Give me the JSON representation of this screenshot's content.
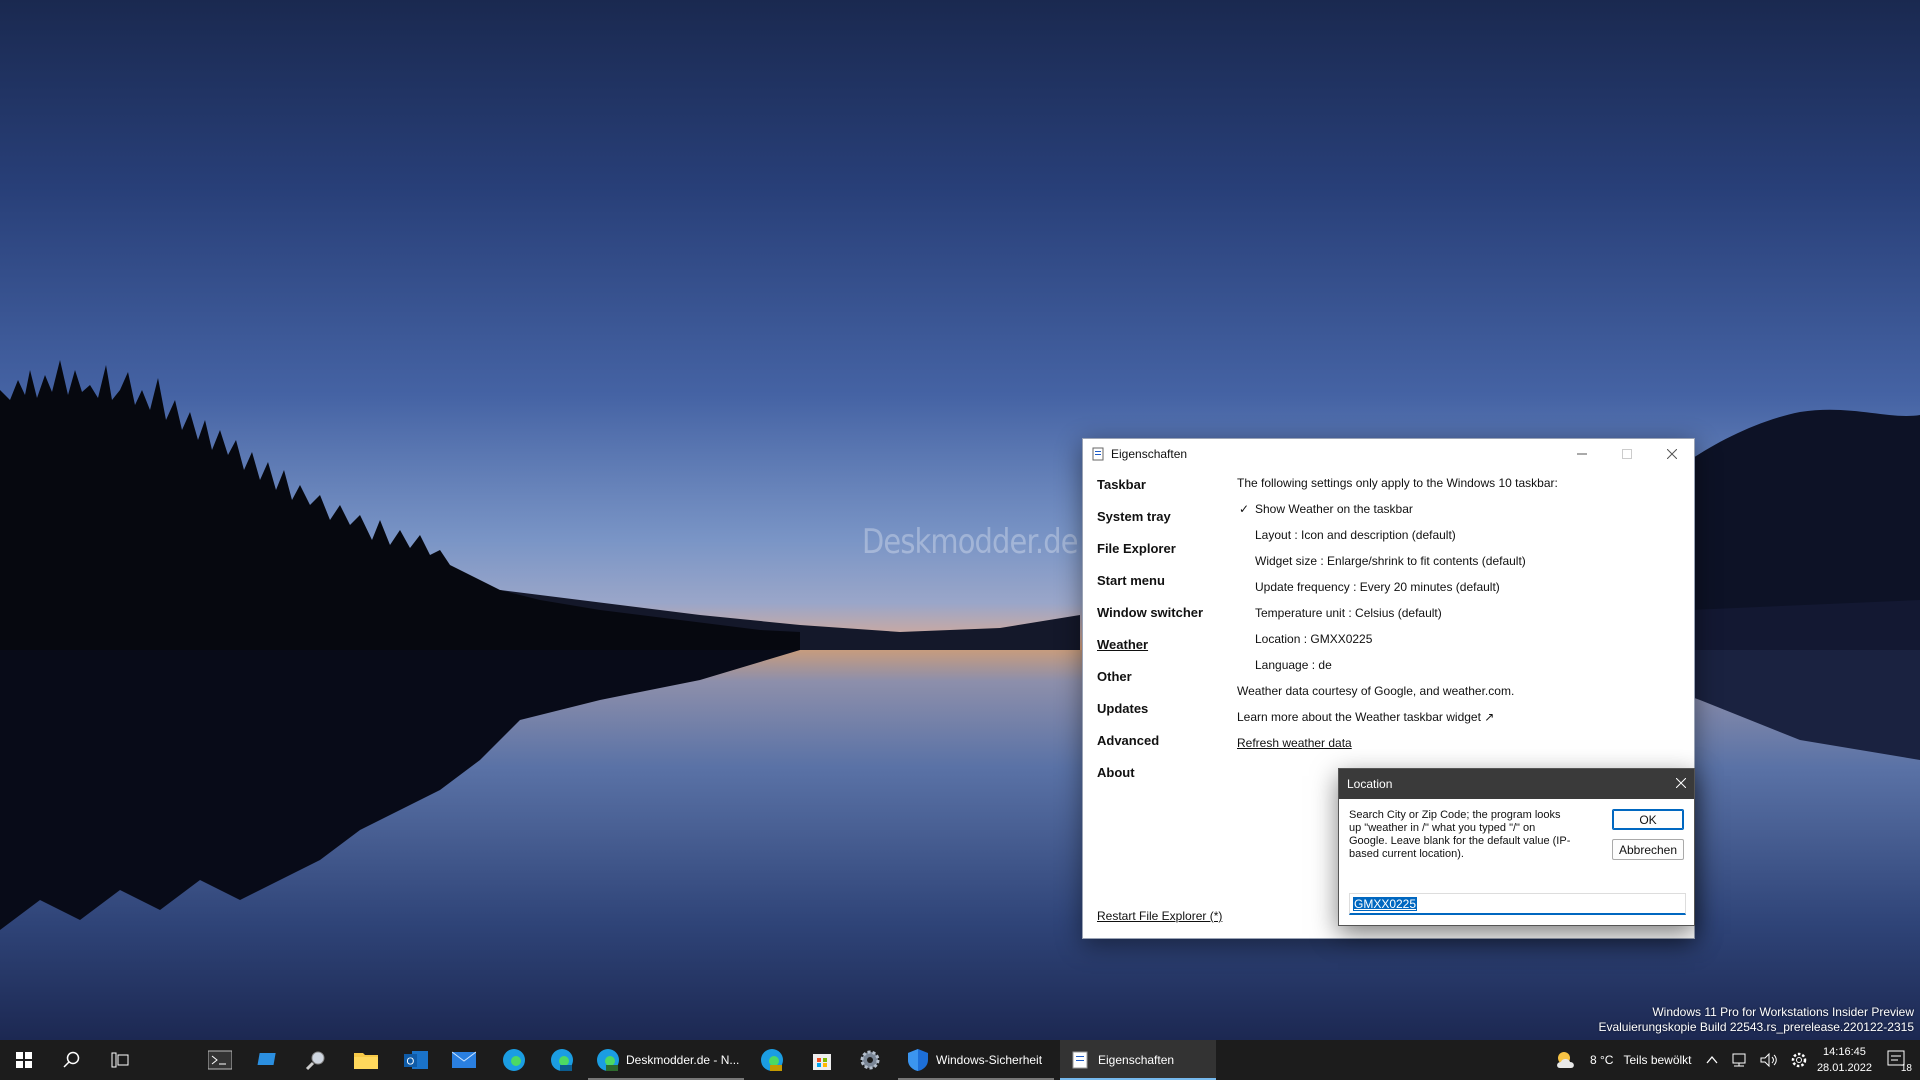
{
  "desktop": {
    "watermark": "Deskmodder.de",
    "windows_version_line1": "Windows 11 Pro for Workstations Insider Preview",
    "windows_version_line2": "Evaluierungskopie Build 22543.rs_prerelease.220122-2315"
  },
  "window": {
    "title": "Eigenschaften",
    "minimize_icon": "minimize-icon",
    "maximize_icon": "maximize-icon",
    "close_icon": "close-icon"
  },
  "sidebar": {
    "items": [
      {
        "label": "Taskbar"
      },
      {
        "label": "System tray"
      },
      {
        "label": "File Explorer"
      },
      {
        "label": "Start menu"
      },
      {
        "label": "Window switcher"
      },
      {
        "label": "Weather",
        "active": true
      },
      {
        "label": "Other"
      },
      {
        "label": "Updates"
      },
      {
        "label": "Advanced"
      },
      {
        "label": "About"
      }
    ],
    "restart_link": "Restart File Explorer (*)"
  },
  "weather": {
    "intro": "The following settings only apply to the Windows 10 taskbar:",
    "show_weather": "Show Weather on the taskbar",
    "show_weather_checked": true,
    "layout": "Layout : Icon and description (default)",
    "widget_size": "Widget size : Enlarge/shrink to fit contents (default)",
    "update_frequency": "Update frequency : Every 20 minutes (default)",
    "temperature_unit": "Temperature unit : Celsius (default)",
    "location": "Location : GMXX0225",
    "language": "Language : de",
    "courtesy": "Weather data courtesy of Google, and weather.com.",
    "learn_more": "Learn more about the Weather taskbar widget ↗",
    "refresh": "Refresh weather data"
  },
  "location_dialog": {
    "title": "Location",
    "description": "Search City or Zip Code; the program looks up \"weather in /\" what you typed \"/\" on Google. Leave blank for the default value (IP-based current location).",
    "ok_label": "OK",
    "cancel_label": "Abbrechen",
    "input_value": "GMXX0225"
  },
  "taskbar": {
    "apps": [
      {
        "label": "Deskmodder.de - N...",
        "icon": "edge-dev-icon"
      },
      {
        "label": "Windows-Sicherheit",
        "icon": "shield-icon"
      },
      {
        "label": "Eigenschaften",
        "icon": "properties-icon",
        "active": true
      }
    ],
    "weather_temp": "8 °C",
    "weather_desc": "Teils bewölkt",
    "time": "14:16:45",
    "date": "28.01.2022",
    "notification_count": "18",
    "accent_color": "#76b9ed"
  }
}
